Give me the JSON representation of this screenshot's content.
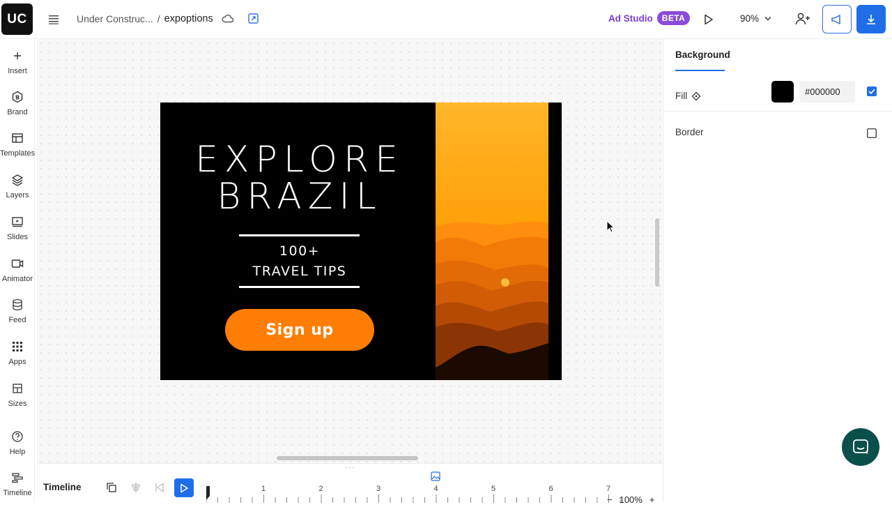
{
  "app": {
    "logo_text": "UC"
  },
  "breadcrumb": {
    "parent": "Under Construc...",
    "separator": "/",
    "current": "expoptions"
  },
  "header": {
    "ad_studio_label": "Ad Studio",
    "beta_label": "BETA",
    "zoom_level": "90%"
  },
  "sidebar": {
    "items": [
      {
        "label": "Insert",
        "icon": "plus-icon"
      },
      {
        "label": "Brand",
        "icon": "brand-icon"
      },
      {
        "label": "Templates",
        "icon": "templates-icon"
      },
      {
        "label": "Layers",
        "icon": "layers-icon"
      },
      {
        "label": "Slides",
        "icon": "slides-icon"
      },
      {
        "label": "Animator",
        "icon": "video-icon"
      },
      {
        "label": "Feed",
        "icon": "database-icon"
      },
      {
        "label": "Apps",
        "icon": "apps-grid-icon"
      },
      {
        "label": "Sizes",
        "icon": "sizes-icon"
      },
      {
        "label": "Help",
        "icon": "help-icon"
      },
      {
        "label": "Timeline",
        "icon": "timeline-icon"
      }
    ]
  },
  "artboard": {
    "headline_line1": "EXPLORE",
    "headline_line2": "BRAZIL",
    "sub_line1": "100+",
    "sub_line2": "TRAVEL TIPS",
    "cta_label": "Sign up",
    "cta_color": "#ff7d03",
    "background_color": "#000000"
  },
  "panel": {
    "tab_label": "Background",
    "fill_label": "Fill",
    "fill_hex": "#000000",
    "fill_enabled": true,
    "border_label": "Border",
    "border_enabled": false,
    "accent_color": "#1f6ee8"
  },
  "timeline": {
    "label": "Timeline",
    "ticks": [
      "1",
      "2",
      "3",
      "4",
      "5",
      "6",
      "7"
    ],
    "zoom_minus": "−",
    "zoom_level": "100%",
    "zoom_plus": "+"
  }
}
